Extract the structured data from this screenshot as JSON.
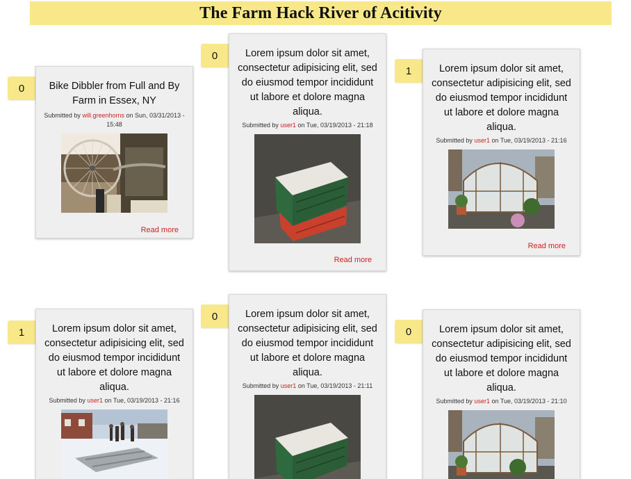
{
  "page": {
    "title": "The Farm Hack River of Acitivity"
  },
  "colors": {
    "banner": "#f8e889",
    "badge": "#f8e889",
    "link": "#cc2222",
    "card_bg": "#efefef"
  },
  "posts": [
    {
      "votes": "0",
      "title": "Bike Dibbler from Full and By Farm in Essex, NY",
      "submitted_prefix": "Submitted by",
      "user": "will.greenhorns",
      "date": "on Sun, 03/31/2013 - 15:48",
      "image": "bike-wheel-photo",
      "read_more": "Read more"
    },
    {
      "votes": "0",
      "title": "Lorem ipsum dolor sit amet, consectetur adipisicing elit, sed do eiusmod tempor incididunt ut labore et dolore magna aliqua.",
      "submitted_prefix": "Submitted by",
      "user": "user1",
      "date": "on Tue, 03/19/2013 - 21:18",
      "image": "crate-box-photo",
      "read_more": "Read more"
    },
    {
      "votes": "1",
      "title": "Lorem ipsum dolor sit amet, consectetur adipisicing elit, sed do eiusmod tempor incididunt ut labore et dolore magna aliqua.",
      "submitted_prefix": "Submitted by",
      "user": "user1",
      "date": "on Tue, 03/19/2013 - 21:16",
      "image": "greenhouse-photo",
      "read_more": "Read more"
    },
    {
      "votes": "1",
      "title": "Lorem ipsum dolor sit amet, consectetur adipisicing elit, sed do eiusmod tempor incididunt ut labore et dolore magna aliqua.",
      "submitted_prefix": "Submitted by",
      "user": "user1",
      "date": "on Tue, 03/19/2013 - 21:16",
      "image": "snowy-farm-photo",
      "read_more": ""
    },
    {
      "votes": "0",
      "title": "Lorem ipsum dolor sit amet, consectetur adipisicing elit, sed do eiusmod tempor incididunt ut labore et dolore magna aliqua.",
      "submitted_prefix": "Submitted by",
      "user": "user1",
      "date": "on Tue, 03/19/2013 - 21:11",
      "image": "crate-box-photo",
      "read_more": ""
    },
    {
      "votes": "0",
      "title": "Lorem ipsum dolor sit amet, consectetur adipisicing elit, sed do eiusmod tempor incididunt ut labore et dolore magna aliqua.",
      "submitted_prefix": "Submitted by",
      "user": "user1",
      "date": "on Tue, 03/19/2013 - 21:10",
      "image": "greenhouse-photo",
      "read_more": ""
    }
  ]
}
